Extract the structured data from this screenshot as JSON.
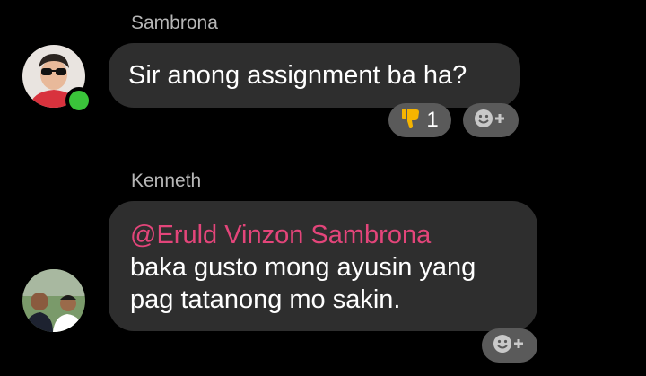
{
  "messages": [
    {
      "sender": "Sambrona",
      "text": "Sir anong assignment ba ha?",
      "reaction": {
        "icon": "thumbs-down-icon",
        "count": "1"
      }
    },
    {
      "sender": "Kenneth",
      "mention": "@Eruld Vinzon Sambrona",
      "text_lines": [
        "baka gusto mong ayusin yang",
        "pag tatanong mo sakin."
      ]
    }
  ],
  "colors": {
    "bubble": "#2e2e2e",
    "mention": "#e3457a",
    "online": "#3ac43a",
    "reaction_pill": "#5a5a5a"
  }
}
